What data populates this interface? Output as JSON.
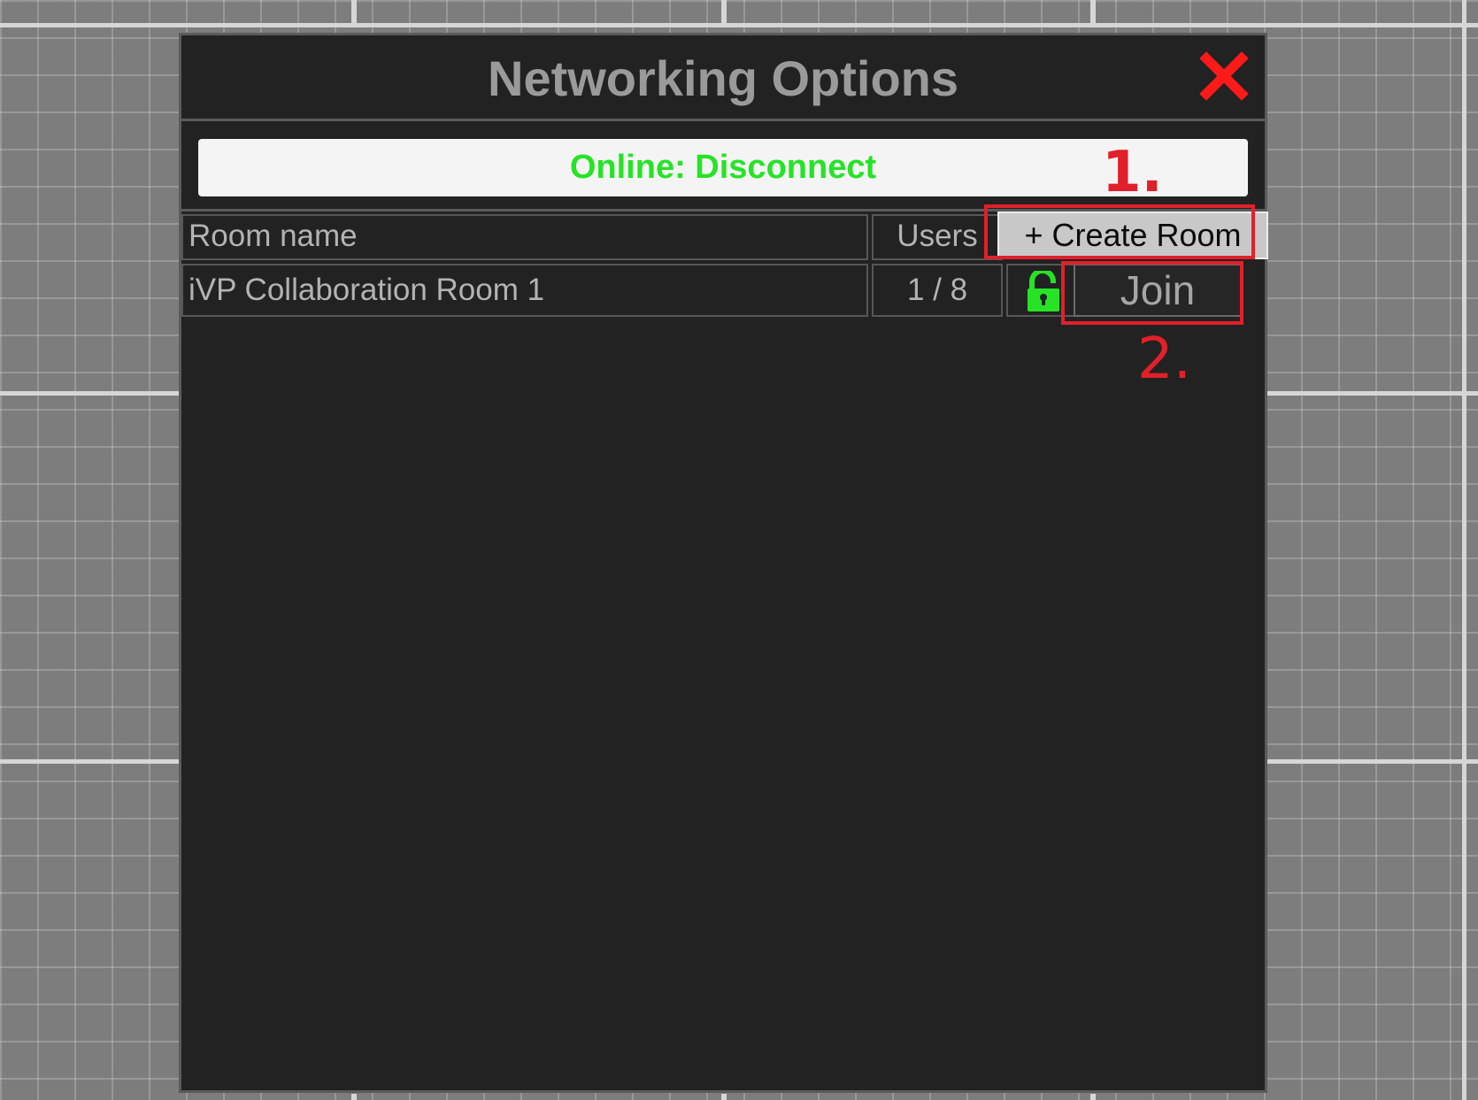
{
  "window": {
    "title": "Networking Options",
    "close_icon": "close-x-icon"
  },
  "status": {
    "label": "Online: Disconnect",
    "color": "#26e326"
  },
  "table": {
    "headers": {
      "room_name": "Room name",
      "users": "Users"
    },
    "create_room_label": "+ Create Room",
    "rows": [
      {
        "room_name": "iVP Collaboration Room 1",
        "users": "1 / 8",
        "lock_icon": "unlocked-padlock-icon",
        "join_label": "Join"
      }
    ]
  },
  "annotations": [
    {
      "label": "1.",
      "target": "create-room-button"
    },
    {
      "label": "2.",
      "target": "join-button"
    }
  ],
  "colors": {
    "accent_green": "#26e326",
    "annotation_red": "#e0202a",
    "close_red": "#ff1a1a",
    "panel_background": "#222222"
  }
}
